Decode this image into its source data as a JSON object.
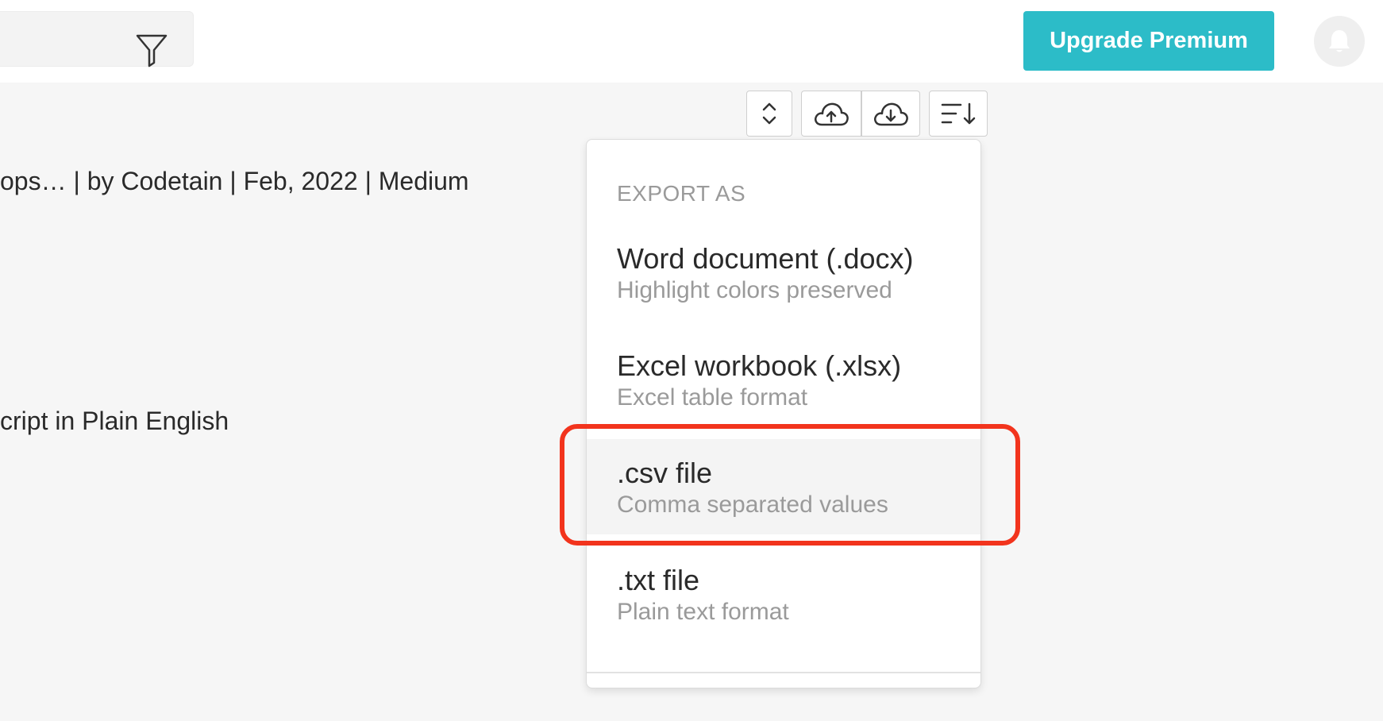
{
  "header": {
    "upgrade_label": "Upgrade Premium"
  },
  "background_text": {
    "line1": "ops… | by Codetain | Feb, 2022 | Medium",
    "line2": "cript in Plain English"
  },
  "icons": {
    "filter": "filter-icon",
    "bell": "bell-icon",
    "expand": "chevron-up-down-icon",
    "upload": "cloud-upload-icon",
    "download": "cloud-download-icon",
    "sort": "sort-icon"
  },
  "export_menu": {
    "header": "EXPORT AS",
    "items": [
      {
        "title": "Word document (.docx)",
        "subtitle": "Highlight colors preserved"
      },
      {
        "title": "Excel workbook (.xlsx)",
        "subtitle": "Excel table format"
      },
      {
        "title": ".csv file",
        "subtitle": "Comma separated values"
      },
      {
        "title": ".txt file",
        "subtitle": "Plain text format"
      }
    ]
  },
  "colors": {
    "accent": "#2cbcc8",
    "highlight": "#f2341d"
  }
}
